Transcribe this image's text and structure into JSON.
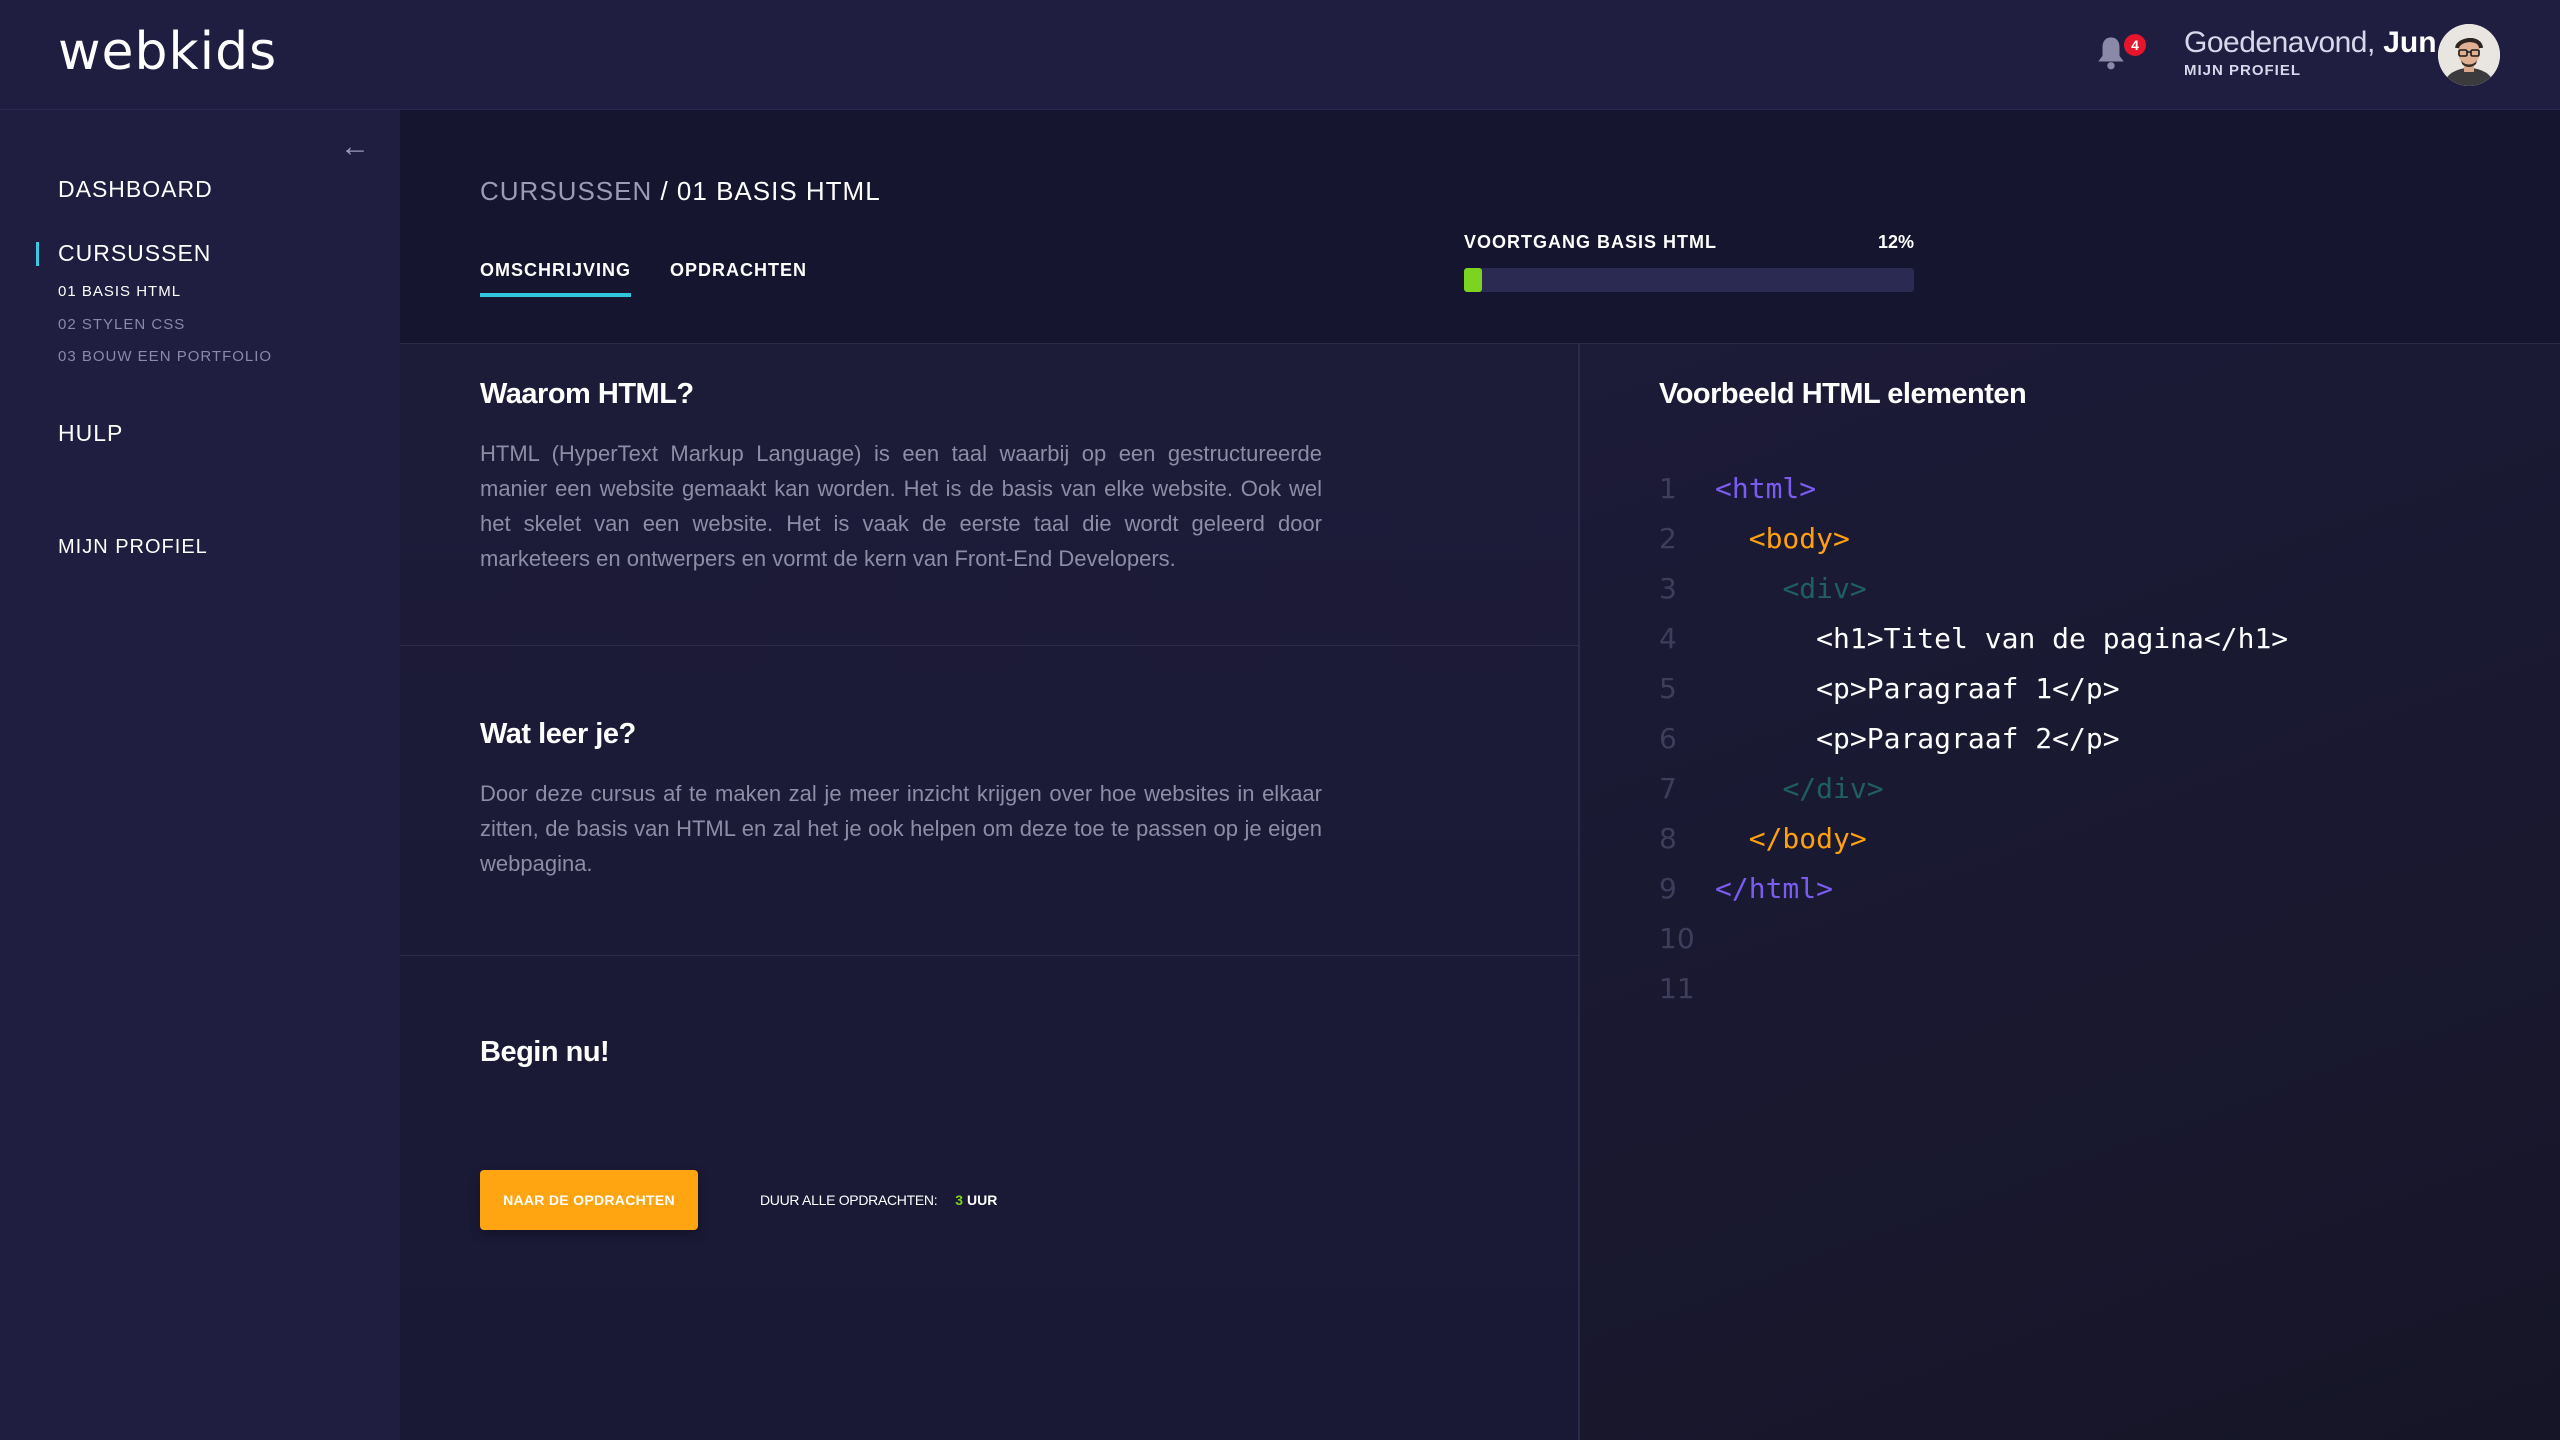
{
  "brand": {
    "logo": "webkids"
  },
  "header": {
    "notification_count": "4",
    "greeting": "Goedenavond,",
    "user_name": "Jun",
    "profile_link": "MIJN PROFIEL"
  },
  "sidebar": {
    "collapse_icon": "arrow-left-icon",
    "items": [
      {
        "label": "DASHBOARD"
      },
      {
        "label": "CURSUSSEN",
        "active": true,
        "subitems": [
          {
            "label": "01 BASIS HTML",
            "active": true
          },
          {
            "label": "02 STYLEN CSS"
          },
          {
            "label": "03 BOUW EEN PORTFOLIO"
          }
        ]
      },
      {
        "label": "HULP"
      },
      {
        "label": "MIJN PROFIEL"
      }
    ]
  },
  "breadcrumb": {
    "parent": "CURSUSSEN",
    "separator": " / ",
    "current": "01 BASIS HTML"
  },
  "tabs": [
    {
      "label": "OMSCHRIJVING",
      "active": true
    },
    {
      "label": "OPDRACHTEN"
    }
  ],
  "progress": {
    "label": "VOORTGANG BASIS HTML",
    "percent_text": "12%",
    "value": 0.04
  },
  "sections": [
    {
      "title": "Waarom HTML?",
      "text": "HTML (HyperText Markup Language) is een taal waarbij op een gestructureerde manier een website gemaakt kan worden. Het is de basis van elke website. Ook wel het skelet van een website. Het is vaak de eerste taal die wordt geleerd door marketeers en ontwerpers en vormt de kern van Front-End Developers."
    },
    {
      "title": "Wat leer je?",
      "text": "Door deze cursus af te maken zal je meer inzicht krijgen over hoe websites in elkaar zitten, de basis van HTML en zal het je ook helpen om deze toe te passen op je eigen webpagina."
    },
    {
      "title": "Begin nu!",
      "button": "NAAR DE OPDRACHTEN",
      "duration_label": "DUUR ALLE OPDRACHTEN:",
      "duration_value": "3",
      "duration_unit": "UUR"
    }
  ],
  "code_panel": {
    "title": "Voorbeeld HTML elementen",
    "lines": [
      {
        "num": "1",
        "code": "<html>",
        "indent": "",
        "color": "#7b5cf0"
      },
      {
        "num": "2",
        "code": "<body>",
        "indent": "  ",
        "color": "#ffa10f"
      },
      {
        "num": "3",
        "code": "<div>",
        "indent": "    ",
        "color": "#1f5e62"
      },
      {
        "num": "4",
        "code": "<h1>Titel van de pagina</h1>",
        "indent": "      ",
        "color": "#ffffff"
      },
      {
        "num": "5",
        "code": "<p>Paragraaf 1</p>",
        "indent": "      ",
        "color": "#ffffff"
      },
      {
        "num": "6",
        "code": "<p>Paragraaf 2</p>",
        "indent": "      ",
        "color": "#ffffff"
      },
      {
        "num": "7",
        "code": "</div>",
        "indent": "    ",
        "color": "#1f5e62"
      },
      {
        "num": "8",
        "code": "</body>",
        "indent": "  ",
        "color": "#ffa10f"
      },
      {
        "num": "9",
        "code": "</html>",
        "indent": "",
        "color": "#7b5cf0"
      },
      {
        "num": "10",
        "code": "",
        "indent": "",
        "color": "#ffffff"
      },
      {
        "num": "11",
        "code": "",
        "indent": "",
        "color": "#ffffff"
      }
    ]
  },
  "colors": {
    "accent_tab": "#2fc6de",
    "progress_fill": "#7dd420",
    "cta": "#ffa512",
    "badge": "#e5162c"
  }
}
